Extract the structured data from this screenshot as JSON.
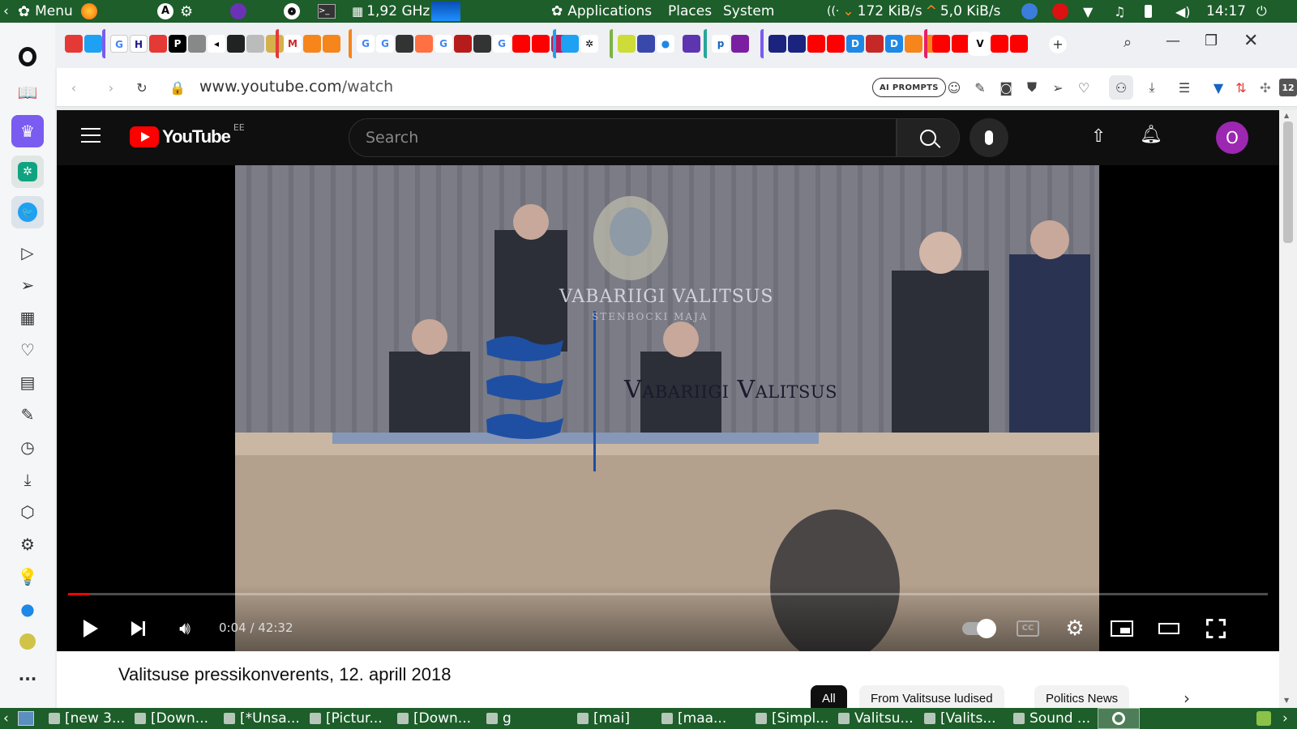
{
  "os_top": {
    "menu_label": "Menu",
    "cpu": "1,92 GHz",
    "applications": "Applications",
    "places": "Places",
    "system": "System",
    "net_down": "172 KiB/s",
    "net_up": "5,0 KiB/s",
    "clock": "14:17"
  },
  "browser": {
    "url_domain": "www.youtube.com",
    "url_path": "/watch",
    "ai_prompts": "AI PROMPTS",
    "badge_12": "12"
  },
  "youtube": {
    "logo_text": "YouTube",
    "country": "EE",
    "search_placeholder": "Search",
    "avatar_letter": "O",
    "time_current": "0:04",
    "time_total": "42:32",
    "progress": 0.0016,
    "video_title": "Valitsuse pressikonverents, 12. aprill 2018",
    "overlay_text": "Vabariigi Valitsus",
    "backdrop_text": "VABARIIGI VALITSUS",
    "backdrop_subtext": "STENBOCKI MAJA",
    "chips": [
      "All",
      "From Valitsuse ludised",
      "Politics News"
    ]
  },
  "colors": {
    "os_panel": "#1d5e2a",
    "yt_red": "#ff0000",
    "avatar": "#9c27b0",
    "opera_accent": "#7a5cf0"
  },
  "taskbar": [
    {
      "label": "[new 3..."
    },
    {
      "label": "[Down..."
    },
    {
      "label": "[*Unsa..."
    },
    {
      "label": "[Pictur..."
    },
    {
      "label": "[Down..."
    },
    {
      "label": "g"
    },
    {
      "label": "[mai]"
    },
    {
      "label": "[maa..."
    },
    {
      "label": "[Simpl..."
    },
    {
      "label": "Valitsu..."
    },
    {
      "label": "[Valits..."
    },
    {
      "label": "Sound ..."
    }
  ]
}
